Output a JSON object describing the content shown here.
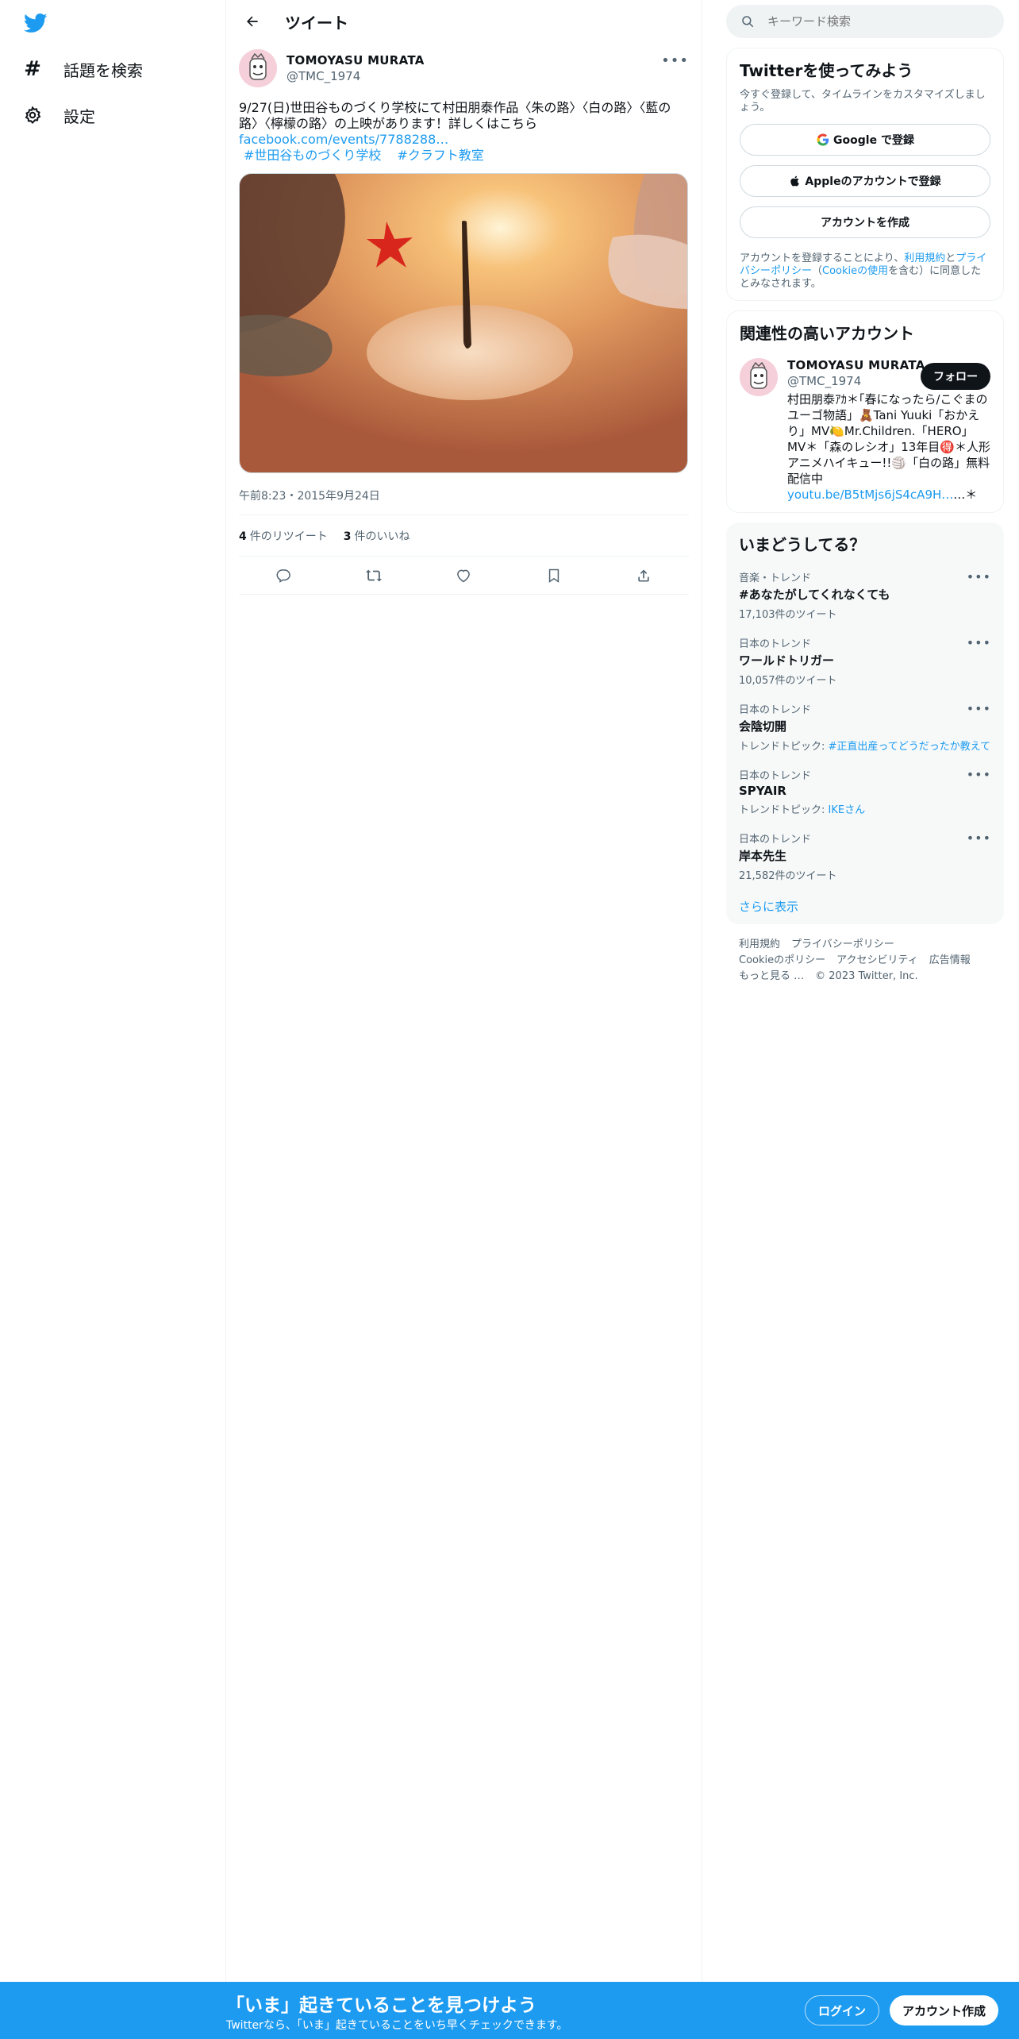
{
  "nav": {
    "logo": "twitter-bird",
    "items": [
      {
        "icon": "hashtag-icon",
        "label": "話題を検索"
      },
      {
        "icon": "gear-icon",
        "label": "設定"
      }
    ]
  },
  "header": {
    "title": "ツイート"
  },
  "tweet": {
    "author_name": "TOMOYASU MURATA",
    "author_handle": "@TMC_1974",
    "text": "9/27(日)世田谷ものづくり学校にて村田朋泰作品〈朱の路〉〈白の路〉〈藍の路〉〈檸檬の路〉の上映があります！詳しくはこちら",
    "link": "facebook.com/events/7788288…",
    "hashtags": [
      "#世田谷ものづくり学校",
      "#クラフト教室"
    ],
    "timestamp": "午前8:23・2015年9月24日",
    "retweets_count": "4",
    "retweets_label": "件のリツイート",
    "likes_count": "3",
    "likes_label": "件のいいね"
  },
  "sidebar": {
    "search_placeholder": "キーワード検索",
    "signup": {
      "title": "Twitterを使ってみよう",
      "subtitle": "今すぐ登録して、タイムラインをカスタマイズしましょう。",
      "google_label": "Google で登録",
      "apple_label": "Appleのアカウントで登録",
      "create_label": "アカウントを作成",
      "legal_prefix": "アカウントを登録することにより、",
      "legal_terms": "利用規約",
      "legal_and": "と",
      "legal_privacy": "プライバシーポリシー",
      "legal_paren_open": "（",
      "legal_cookie": "Cookieの使用",
      "legal_suffix": "を含む）に同意したとみなされます。"
    },
    "related": {
      "title": "関連性の高いアカウント",
      "name": "TOMOYASU MURATA",
      "handle": "@TMC_1974",
      "follow_label": "フォロー",
      "bio": "村田朋泰ｱｶ＊｢春になったら/こぐまのユーゴ物語」🧸Tani Yuuki「おかえり」MV🍋Mr.Children.「HERO」MV＊「森のレシオ」13年目🉐＊人形アニメハイキュー!!🏐「白の路」無料配信中",
      "bio_link": "youtu.be/B5tMjs6jS4cA9H…",
      "bio_tail": "…＊"
    },
    "trends": {
      "title": "いまどうしてる？",
      "items": [
        {
          "meta": "音楽・トレンド",
          "name": "#あなたがしてくれなくても",
          "count": "17,103件のツイート",
          "topic_label": "",
          "topic": ""
        },
        {
          "meta": "日本のトレンド",
          "name": "ワールドトリガー",
          "count": "10,057件のツイート",
          "topic_label": "",
          "topic": ""
        },
        {
          "meta": "日本のトレンド",
          "name": "会陰切開",
          "count": "",
          "topic_label": "トレンドトピック: ",
          "topic": "#正直出産ってどうだったか教えて"
        },
        {
          "meta": "日本のトレンド",
          "name": "SPYAIR",
          "count": "",
          "topic_label": "トレンドトピック: ",
          "topic": "IKEさん"
        },
        {
          "meta": "日本のトレンド",
          "name": "岸本先生",
          "count": "21,582件のツイート",
          "topic_label": "",
          "topic": ""
        }
      ],
      "show_more": "さらに表示"
    },
    "footer": {
      "links_row1": [
        "利用規約",
        "プライバシーポリシー"
      ],
      "links_row2": [
        "Cookieのポリシー",
        "アクセシビリティ",
        "広告情報"
      ],
      "more": "もっと見る …",
      "copyright": "© 2023 Twitter, Inc."
    }
  },
  "banner": {
    "title": "「いま」起きていることを見つけよう",
    "subtitle": "Twitterなら、「いま」起きていることをいち早くチェックできます。",
    "login_label": "ログイン",
    "signup_label": "アカウント作成"
  },
  "colors": {
    "accent": "#1d9bf0",
    "text": "#0f1419",
    "muted": "#536471",
    "border": "#eff3f4"
  }
}
